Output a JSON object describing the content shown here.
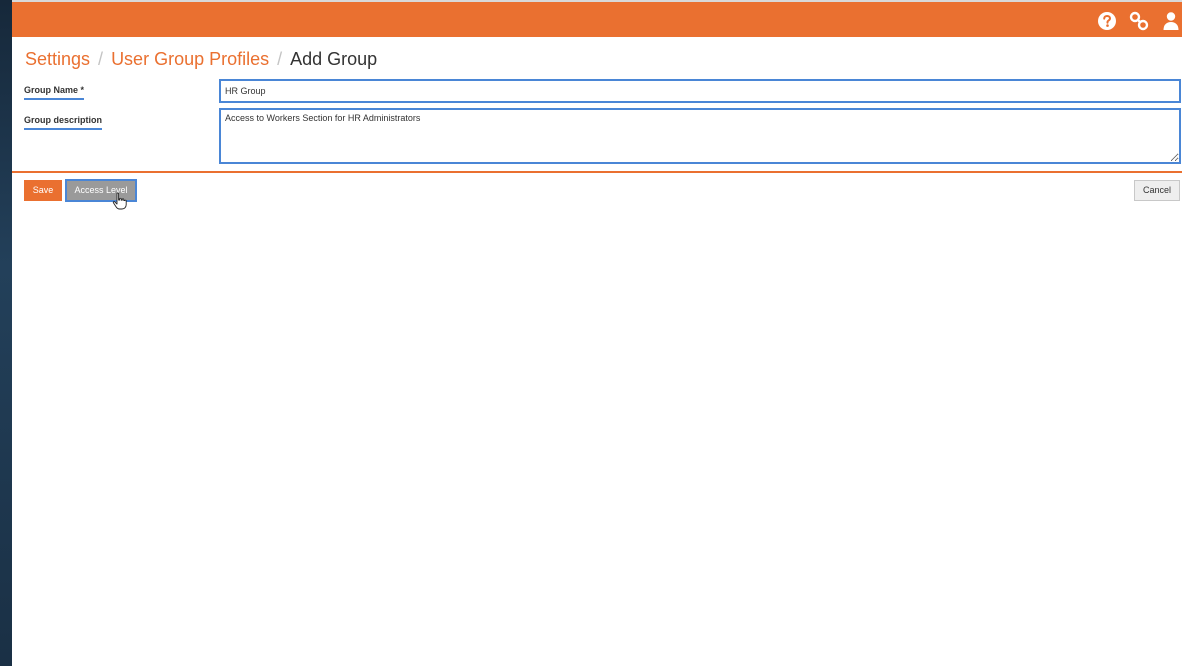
{
  "header": {
    "icons": [
      "help-circle-icon",
      "link-icon",
      "user-icon"
    ]
  },
  "breadcrumb": {
    "items": [
      "Settings",
      "User Group Profiles"
    ],
    "separator": "/",
    "current": "Add Group"
  },
  "form": {
    "group_name": {
      "label": "Group Name *",
      "value": "HR Group"
    },
    "group_description": {
      "label": "Group description",
      "value": "Access to Workers Section for HR Administrators"
    }
  },
  "actions": {
    "save_label": "Save",
    "access_level_label": "Access Level",
    "cancel_label": "Cancel"
  },
  "colors": {
    "accent": "#ea7030",
    "focus_border": "#4a86d6",
    "button_gray": "#9a9a9a"
  }
}
